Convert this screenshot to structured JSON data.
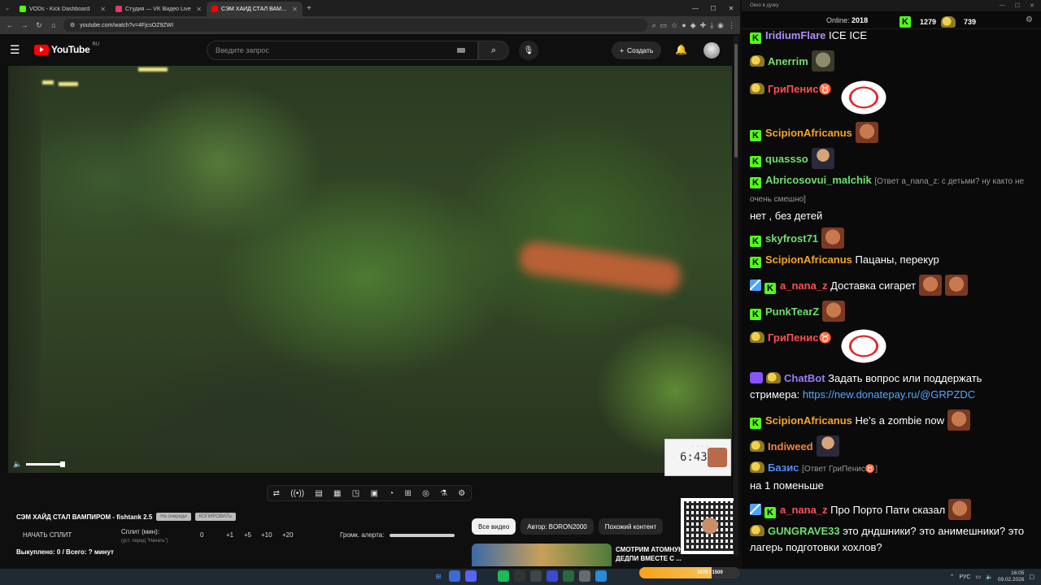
{
  "browser": {
    "tabs": [
      {
        "label": "VODs - Kick Dashboard",
        "color": "#53fc18"
      },
      {
        "label": "Студия — VK Видео Live",
        "color": "#e23a6a"
      },
      {
        "label": "СЭМ ХАЙД СТАЛ ВАМПИ",
        "color": "#ff0000",
        "active": true
      }
    ],
    "url": "youtube.com/watch?v=4FjcsOZ9ZWI"
  },
  "youtube": {
    "logo": "YouTube",
    "region": "RU",
    "search_placeholder": "Введите запрос",
    "create_label": "Создать"
  },
  "overlay": {
    "timer": "6:43:",
    "title": "СЭМ ХАЙД СТАЛ ВАМПИРОМ - fishtank 2.5",
    "pill1": "На очереди",
    "pill2": "КОПИРОВАТЬ",
    "start_split": "НАЧАТЬ СПЛИТ",
    "split_min": "Сплит (мин):",
    "split_hint": "(уст. перед \"Начать\")",
    "split_values": [
      "0",
      "+1",
      "+5",
      "+10",
      "+20"
    ],
    "alert_volume": "Громк. алерта:",
    "bought": "Выкуплено: 0 / Всего: ? минут"
  },
  "chips": [
    "Все видео",
    "Автор: BORON2000",
    "Похожий контент"
  ],
  "rec": {
    "title": "СМОТРИМ АТОМНУЮ БОМБУ ДЕДПИ ВМЕСТЕ С ..."
  },
  "taskbar": {
    "progress_label": "1075 / 1500",
    "progress_fraction": 0.72,
    "lang": "РУС",
    "time": "16:05",
    "date": "09.02.2026"
  },
  "chat": {
    "window_title": "Окно в дуэку",
    "online_label": "Online:",
    "online_count": "2018",
    "stat1": "1279",
    "stat2": "739",
    "messages": [
      {
        "user": "IridiumFlare",
        "color": "#b18cff",
        "badge": "kick",
        "text": "ICE ICE"
      },
      {
        "user": "Anerrim",
        "color": "#6ee06a",
        "badge": "mb",
        "text": ""
      },
      {
        "user": "ГриПенис♉",
        "color": "#ff4f4f",
        "badge": "mb",
        "text": ""
      },
      {
        "user": "ScipionAfricanus",
        "color": "#f5a623",
        "badge": "kick",
        "text": ""
      },
      {
        "user": "quassso",
        "color": "#6ee06a",
        "badge": "kick",
        "text": ""
      },
      {
        "user": "Abricosovui_malchik",
        "color": "#6ee06a",
        "badge": "kick",
        "reply": "[Ответ a_nana_z: с детьми? ну както не очень смешно]",
        "text": "нет , без детей"
      },
      {
        "user": "skyfrost71",
        "color": "#6ee06a",
        "badge": "kick",
        "text": ""
      },
      {
        "user": "ScipionAfricanus",
        "color": "#f5a623",
        "badge": "kick",
        "text": "Пацаны, перекур"
      },
      {
        "user": "a_nana_z",
        "color": "#ff4f4f",
        "badge": "sw",
        "text": "Доставка сигарет"
      },
      {
        "user": "PunkTearZ",
        "color": "#6ee06a",
        "badge": "kick",
        "text": ""
      },
      {
        "user": "ГриПенис♉",
        "color": "#ff4f4f",
        "badge": "mb",
        "text": ""
      },
      {
        "user": "ChatBot",
        "color": "#9a7bff",
        "badge": "bot",
        "text": "Задать вопрос или поддержать стримера:",
        "link": "https://new.donatepay.ru/@GRPZDC"
      },
      {
        "user": "ScipionAfricanus",
        "color": "#f5a623",
        "badge": "kick",
        "text": "He's a zombie now"
      },
      {
        "user": "Indiweed",
        "color": "#f5823a",
        "badge": "mb",
        "text": ""
      },
      {
        "user": "Базис",
        "color": "#4f8cff",
        "badge": "mb",
        "reply": "[Ответ ГриПенис♉]",
        "text": "на 1 поменьше"
      },
      {
        "user": "a_nana_z",
        "color": "#ff4f4f",
        "badge": "sw",
        "text": "Про Порто Пати сказал"
      },
      {
        "user": "GUNGRAVE33",
        "color": "#6ee06a",
        "badge": "mb",
        "text": "это дндшники? это анимешники? это лагерь подготовки хохлов?"
      }
    ]
  }
}
